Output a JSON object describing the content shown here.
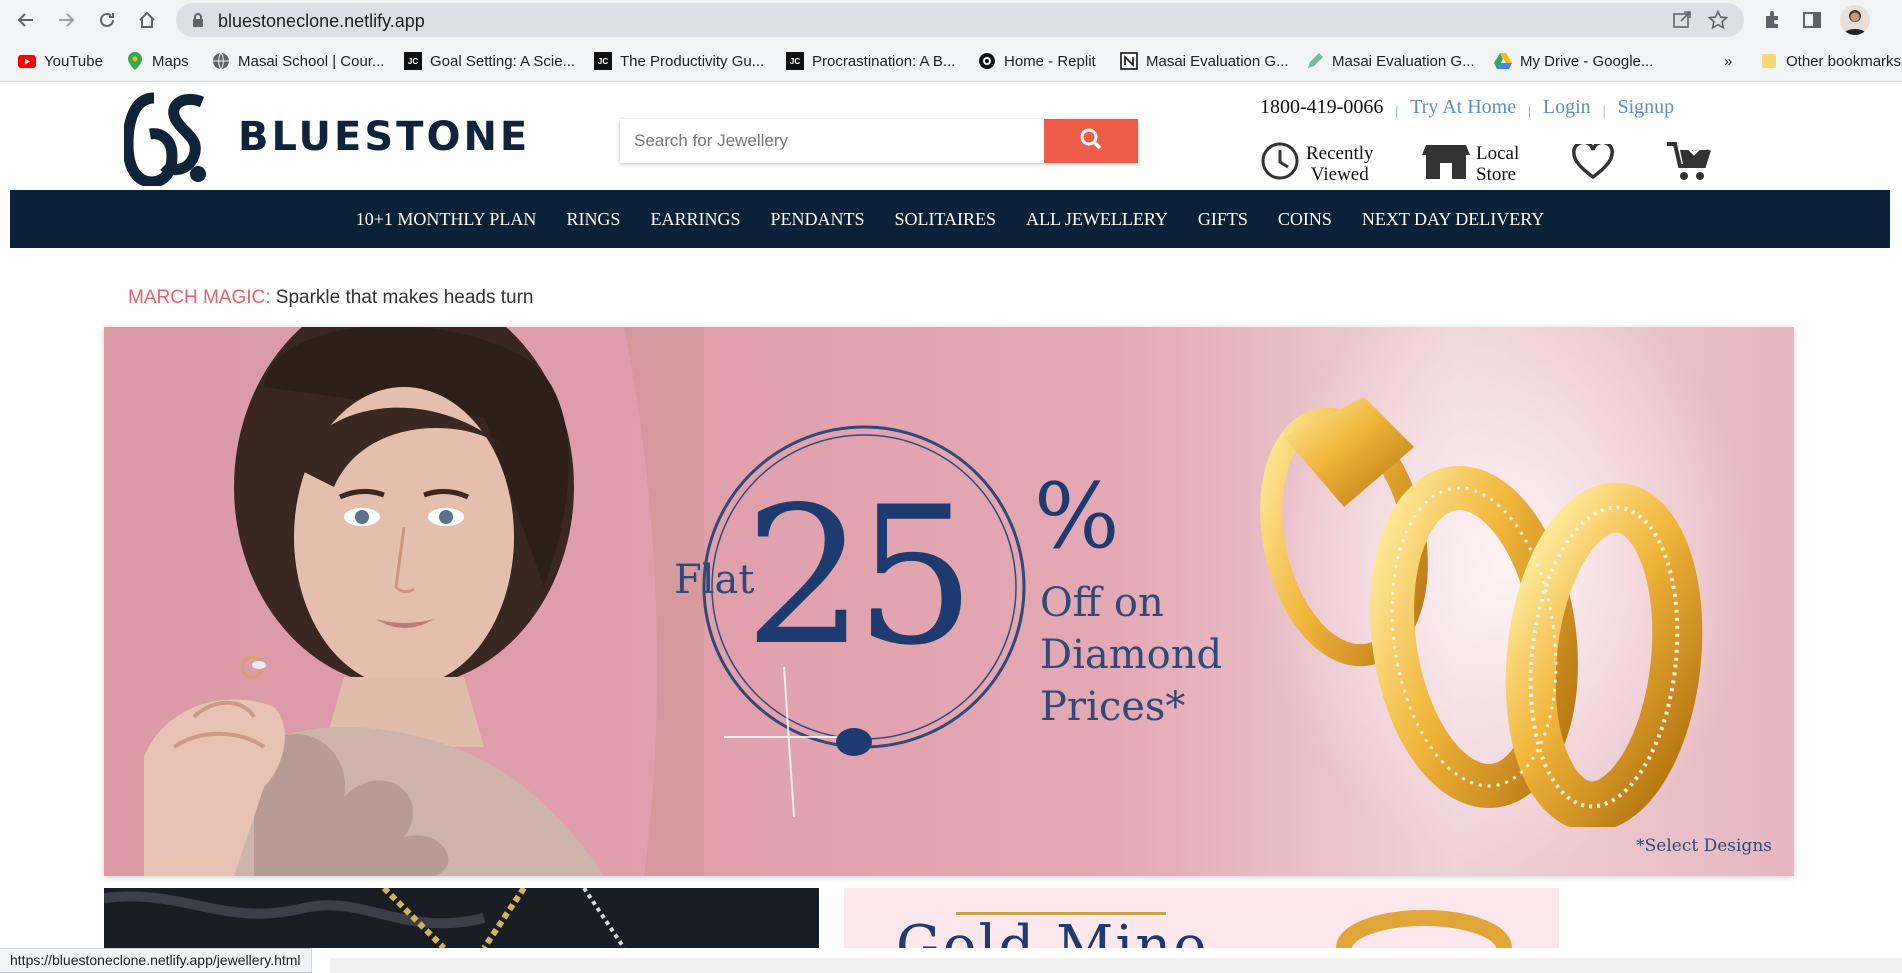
{
  "browser": {
    "url": "bluestoneclone.netlify.app",
    "bookmarks": [
      {
        "label": "YouTube",
        "icon": "youtube-icon"
      },
      {
        "label": "Maps",
        "icon": "maps-icon"
      },
      {
        "label": "Masai School | Cour...",
        "icon": "globe-icon"
      },
      {
        "label": "Goal Setting: A Scie...",
        "icon": "jc-icon"
      },
      {
        "label": "The Productivity Gu...",
        "icon": "jc-icon"
      },
      {
        "label": "Procrastination: A B...",
        "icon": "jc-icon"
      },
      {
        "label": "Home - Replit",
        "icon": "replit-icon"
      },
      {
        "label": "Masai Evaluation G...",
        "icon": "notion-icon"
      },
      {
        "label": "Masai Evaluation G...",
        "icon": "pencil-icon"
      },
      {
        "label": "My Drive - Google...",
        "icon": "drive-icon"
      }
    ],
    "more_bookmarks": "»",
    "other_bookmarks": "Other bookmarks",
    "status_url": "https://bluestoneclone.netlify.app/jewellery.html"
  },
  "site": {
    "brand": "BLUESTONE",
    "search_placeholder": "Search for Jewellery",
    "phone": "1800-419-0066",
    "separator": "|",
    "links": {
      "try_at_home": "Try At Home",
      "login": "Login",
      "signup": "Signup"
    },
    "recently_viewed": {
      "line1": "Recently",
      "line2": "Viewed"
    },
    "local_store": {
      "line1": "Local",
      "line2": "Store"
    },
    "nav": [
      "10+1 MONTHLY PLAN",
      "RINGS",
      "EARRINGS",
      "PENDANTS",
      "SOLITAIRES",
      "ALL JEWELLERY",
      "GIFTS",
      "COINS",
      "NEXT DAY DELIVERY"
    ],
    "promo": {
      "highlight": "MARCH MAGIC:",
      "text": " Sparkle that makes heads turn"
    },
    "banner": {
      "flat": "Flat",
      "number": "25",
      "percent": "%",
      "off_line1": "Off on",
      "off_line2": "Diamond",
      "off_line3": "Prices*",
      "note": "*Select Designs"
    },
    "tile2_text": "Gold Mine"
  },
  "colors": {
    "brand_navy": "#0b2138",
    "search_button": "#ef5d4a",
    "link_blue": "#5b8fc4",
    "promo_highlight": "#ef5d66"
  }
}
